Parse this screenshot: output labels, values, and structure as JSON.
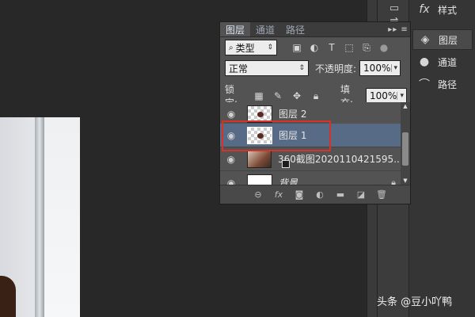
{
  "panel": {
    "tabs": [
      "图层",
      "通道",
      "路径"
    ],
    "menu_icon": "panel-menu-icon",
    "filter_label": "类型",
    "filter_icons": [
      "image-filter-icon",
      "adjustment-filter-icon",
      "type-filter-icon",
      "shape-filter-icon",
      "smart-object-filter-icon",
      "filter-toggle-icon"
    ],
    "blend_mode": "正常",
    "opacity_label": "不透明度:",
    "opacity_value": "100%",
    "lock_label": "锁定:",
    "lock_icons": [
      "lock-transparent-icon",
      "lock-paint-icon",
      "lock-position-icon",
      "lock-all-icon"
    ],
    "fill_label": "填充:",
    "fill_value": "100%",
    "layers": [
      {
        "name": "图层 2",
        "thumb": "transparent",
        "selected": false
      },
      {
        "name": "图层 1",
        "thumb": "transparent",
        "selected": true
      },
      {
        "name": "360截图2020110421595...",
        "thumb": "photo",
        "selected": false
      },
      {
        "name": "背景",
        "thumb": "white",
        "selected": false,
        "locked": true
      }
    ],
    "footer_icons": [
      "link-layers-icon",
      "fx-icon",
      "mask-icon",
      "adjustment-icon",
      "group-icon",
      "new-layer-icon",
      "trash-icon"
    ]
  },
  "dock": {
    "items": [
      {
        "label": "样式",
        "icon": "fx-icon"
      },
      {
        "label": "图层",
        "icon": "layers-icon",
        "active": true
      },
      {
        "label": "通道",
        "icon": "channels-icon"
      },
      {
        "label": "路径",
        "icon": "paths-icon"
      }
    ]
  },
  "watermark": "头条 @豆小吖鸭",
  "colors": {
    "panel_bg": "#535353",
    "selected_layer": "#576a86",
    "highlight_box": "#d6322a",
    "canvas_bg": "#282828"
  }
}
